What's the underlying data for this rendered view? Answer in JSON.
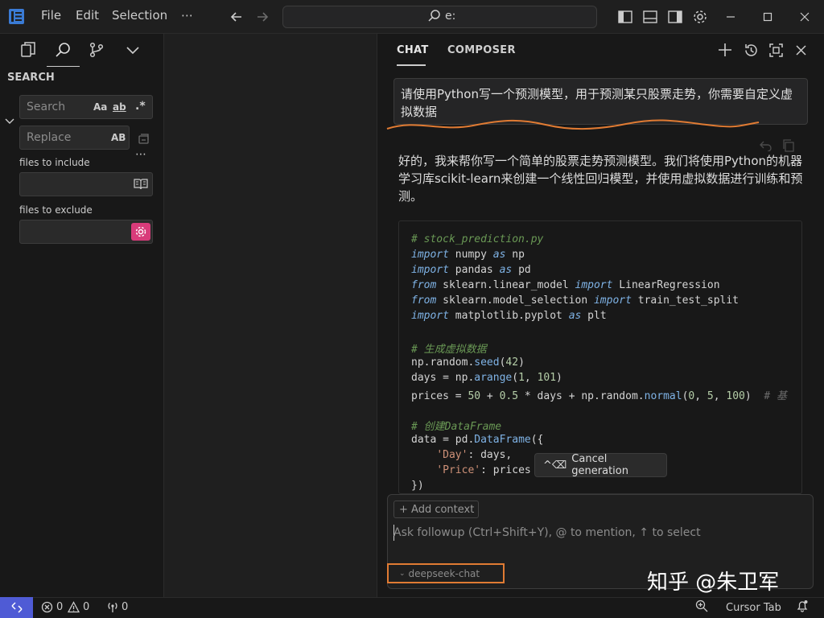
{
  "titlebar": {
    "menu": [
      "File",
      "Edit",
      "Selection",
      "⋯"
    ],
    "command_center_text": "e:"
  },
  "sidebar": {
    "title": "SEARCH",
    "search_placeholder": "Search",
    "replace_placeholder": "Replace",
    "match_case": "Aa",
    "whole_word": "ab",
    "regex": ".*",
    "preserve_case": "AB",
    "more": "⋯",
    "files_to_include_label": "files to include",
    "files_to_exclude_label": "files to exclude"
  },
  "chat": {
    "tabs": [
      "CHAT",
      "COMPOSER"
    ],
    "user_message": "请使用Python写一个预测模型，用于预测某只股票走势，你需要自定义虚拟数据",
    "assistant_message": "好的，我来帮你写一个简单的股票走势预测模型。我们将使用Python的机器学习库scikit-learn来创建一个线性回归模型，并使用虚拟数据进行训练和预测。",
    "code": {
      "comment_filename": "# stock_prediction.py",
      "line_import_numpy": [
        "import",
        " numpy ",
        "as",
        " np"
      ],
      "line_import_pandas": [
        "import",
        " pandas ",
        "as",
        " pd"
      ],
      "line_from_linear": [
        "from",
        " sklearn.linear_model ",
        "import",
        " LinearRegression"
      ],
      "line_from_selection": [
        "from",
        " sklearn.model_selection ",
        "import",
        " train_test_split"
      ],
      "line_import_plt": [
        "import",
        " matplotlib.pyplot ",
        "as",
        " plt"
      ],
      "comment_generate": "# 生成虚拟数据",
      "line_seed": [
        "np.random.",
        "seed",
        "(",
        "42",
        ")"
      ],
      "line_days": [
        "days = np.",
        "arange",
        "(",
        "1",
        ", ",
        "101",
        ")"
      ],
      "line_prices": [
        "prices = ",
        "50",
        " + ",
        "0.5",
        " * days + np.random.",
        "normal",
        "(",
        "0",
        ", ",
        "5",
        ", ",
        "100",
        ")  ",
        "# 基"
      ],
      "comment_dataframe": "# 创建DataFrame",
      "line_data": [
        "data = pd.",
        "DataFrame",
        "({"
      ],
      "line_day_key": [
        "    ",
        "'Day'",
        ": days,"
      ],
      "line_price_key": [
        "    ",
        "'Price'",
        ": prices"
      ],
      "line_close": "})"
    },
    "cancel_generation": "Cancel generation",
    "cancel_shortcut": "^⌫",
    "add_context": "+ Add context",
    "followup_placeholder": "Ask followup (Ctrl+Shift+Y), @ to mention, ↑ to select",
    "model": "deepseek-chat"
  },
  "watermark": "知乎 @朱卫军",
  "statusbar": {
    "errors": "0",
    "warnings": "0",
    "ports": "0",
    "cursor_tab": "Cursor Tab"
  },
  "colors": {
    "accent_remote": "#4f5bd5",
    "annotation_orange": "#e07b33",
    "exclude_gear": "#d83b7a"
  }
}
